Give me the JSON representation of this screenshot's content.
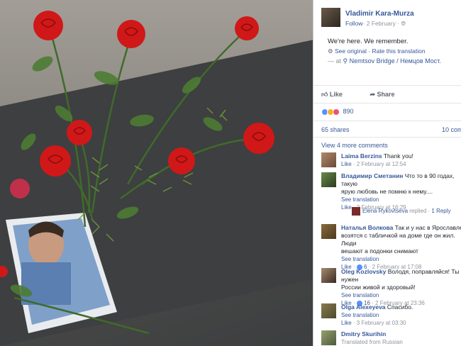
{
  "post": {
    "author": "Vladimir Kara-Murza",
    "follow": "Follow",
    "date": "· 2 February · ",
    "text": "We're here. We remember.",
    "see_original": "See original",
    "rate": "· Rate this translation",
    "at_prefix": "— at",
    "location": "Nemtsov Bridge / Немцов Мост.",
    "like_label": "Like",
    "share_label": "Share",
    "reaction_count": "890",
    "shares": "65 shares",
    "comments_count": "10 com",
    "view_more": "View 4 more comments"
  },
  "comments": [
    {
      "author": "Laima Berzins",
      "text": "Thank you!",
      "like": "Like",
      "time": "· 2 February at 12:54"
    },
    {
      "author": "Владимир Сметанин",
      "text": "Что то в 90 годах, такую",
      "text2": "ярую любовь не помню к нему....",
      "see_translation": "See translation",
      "like": "Like",
      "time": "· 2 February at 16:29"
    },
    {
      "author": "Наталья Волкова",
      "text": "Так и у нас в Ярославле",
      "text2": "возятся с табличкой на доме где он жил. Люди",
      "text3": "вешают а подонки снимают",
      "see_translation": "See translation",
      "like": "Like",
      "likes": "6",
      "time": "· 2 February at 17:08"
    },
    {
      "author": "Oleg Kozlovsky",
      "text": "Володя, поправляйся! Ты нужен",
      "text2": "России живой и здоровый!",
      "see_translation": "See translation",
      "like": "Like",
      "likes": "16",
      "time": "· 2 February at 23:36"
    },
    {
      "author": "Olga Alexeyeva",
      "text": "Спасибо.",
      "see_translation": "See translation",
      "like": "Like",
      "time": "· 3 February at 03:30"
    },
    {
      "author": "Dmitry Skurihin",
      "text": "Translated from Russian"
    }
  ],
  "reply": {
    "name": "Elena Rykovtseva",
    "action": "replied ·",
    "count": "1 Reply"
  },
  "colors": {
    "link": "#365899",
    "meta": "#90949c",
    "rose": "#d01818",
    "leaf": "#3f6b2a"
  }
}
